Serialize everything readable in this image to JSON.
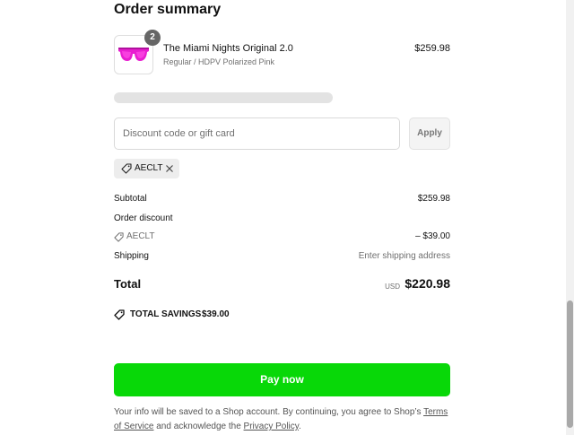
{
  "order_summary": {
    "title": "Order summary"
  },
  "product": {
    "quantity": "2",
    "name": "The Miami Nights Original 2.0",
    "variant": "Regular / HDPV Polarized Pink",
    "price": "$259.98",
    "image_icon": "sunglasses-pink"
  },
  "discount": {
    "placeholder": "Discount code or gift card",
    "value": "",
    "apply_label": "Apply",
    "applied_code": "AECLT"
  },
  "summary": {
    "subtotal_label": "Subtotal",
    "subtotal_value": "$259.98",
    "order_discount_label": "Order discount",
    "discount_code": "AECLT",
    "discount_value": "– $39.00",
    "shipping_label": "Shipping",
    "shipping_value": "Enter shipping address",
    "total_label": "Total",
    "total_currency": "USD",
    "total_value": "$220.98",
    "savings_label": "TOTAL SAVINGS",
    "savings_value": "$39.00"
  },
  "pay": {
    "label": "Pay now"
  },
  "legal": {
    "text_before": "Your info will be saved to a Shop account. By continuing, you agree to Shop’s ",
    "terms_link": "Terms of Service",
    "text_middle": " and acknowledge the ",
    "privacy_link": "Privacy Policy",
    "text_after": "."
  },
  "colors": {
    "pay_button": "#08d808",
    "text": "#111111",
    "muted": "#707070"
  }
}
